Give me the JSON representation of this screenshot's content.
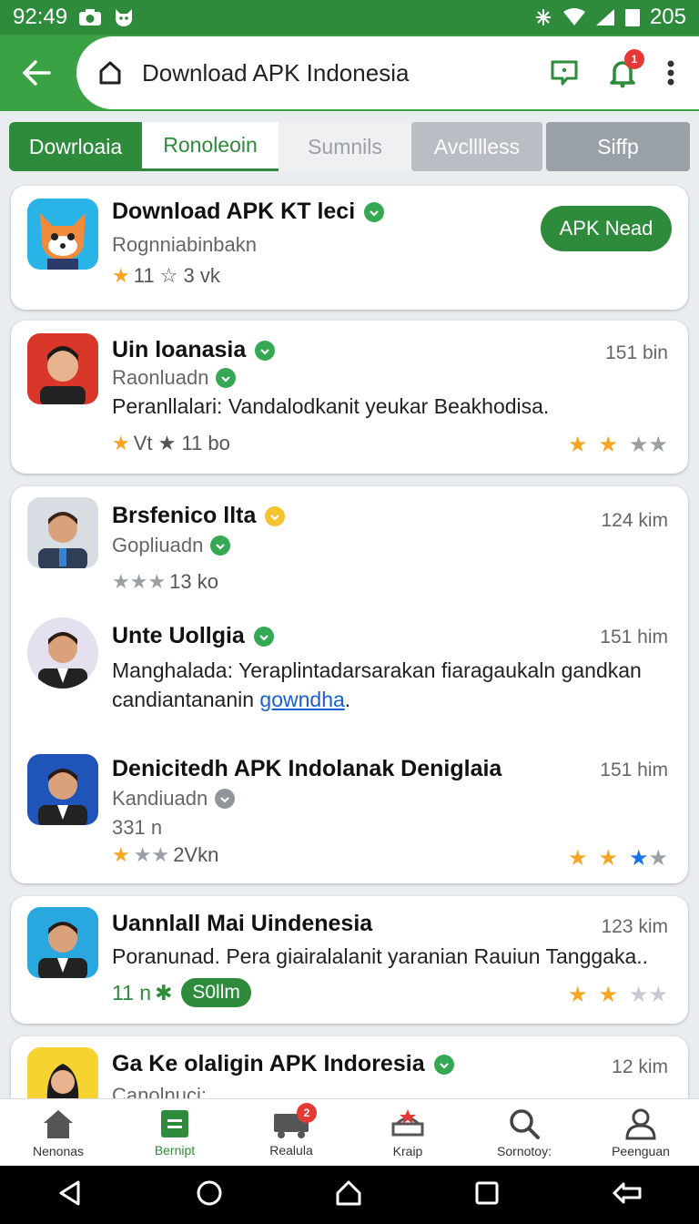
{
  "status_bar": {
    "time": "92:49",
    "battery": "205"
  },
  "app_bar": {
    "url": "Download APK Indonesia",
    "notification_badge": "1"
  },
  "tabs": [
    "Dowrloaia",
    "Ronoleoin",
    "Sumnils",
    "Avclllless",
    "Siffp"
  ],
  "cards": [
    {
      "title": "Download APK KT leci",
      "sub": "Rognniabinbakn",
      "rating": "11 ☆ 3 vk",
      "button": "APK Nead"
    },
    {
      "title": "Uin loanasia",
      "sub": "Raonluadn",
      "desc": "Peranllalari: Vandalodkanit yeukar Beakhodisa.",
      "rating": "Vt ★ 11 bo",
      "time": "151 bin"
    },
    {
      "title": "Brsfenico llta",
      "sub": "Gopliuadn",
      "rating": "13 ko",
      "time": "124 kim"
    },
    {
      "title": "Unte Uollgia",
      "desc_a": "Manghalada: Yeraplintadarsarakan fiaragaukaln gandkan candiantananin",
      "desc_link": "gowndha",
      "desc_end": ".",
      "time": "151 him"
    },
    {
      "title": "Denicitedh APK Indolanak Deniglaia",
      "sub": "Kandiuadn",
      "extra": "331 n",
      "rating": "2Vkn",
      "time": "151 him"
    },
    {
      "title": "Uannlall Mai Uindenesia",
      "desc": "Poranunad. Pera giairalalanit yaranian Rauiun Tanggaka..",
      "rating": "11 n",
      "pill": "S0llm",
      "time": "123 kim"
    },
    {
      "title": "Ga Ke olaligin APK Indoresia",
      "sub": "Canolnuci:",
      "time": "12 kim"
    }
  ],
  "bottom_nav": [
    {
      "label": "Nenonas"
    },
    {
      "label": "Bernipt"
    },
    {
      "label": "Realula",
      "badge": "2"
    },
    {
      "label": "Kraip"
    },
    {
      "label": "Sornotoy:"
    },
    {
      "label": "Peenguan"
    }
  ],
  "colors": {
    "primary": "#2e8b3c",
    "accent_light": "#3aa145",
    "star": "#f5a623",
    "badge": "#e53935"
  }
}
